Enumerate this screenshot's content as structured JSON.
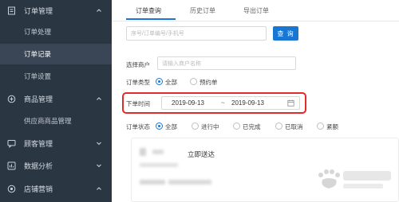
{
  "sidebar": {
    "sections": [
      {
        "label": "订单管理",
        "icon": "document-icon",
        "expanded": true
      },
      {
        "label": "商品管理",
        "icon": "add-circle-icon",
        "expanded": true
      },
      {
        "label": "顾客管理",
        "icon": "chat-icon",
        "expanded": false
      },
      {
        "label": "数据分析",
        "icon": "chart-box-icon",
        "expanded": false
      },
      {
        "label": "店铺营销",
        "icon": "target-icon",
        "expanded": true
      }
    ],
    "order_items": [
      "订单处理",
      "订单记录",
      "订单设置"
    ],
    "product_items": [
      "供应商商品管理"
    ],
    "active_item": "订单记录"
  },
  "tabs": [
    "订单查询",
    "历史订单",
    "导出订单"
  ],
  "search": {
    "placeholder": "序号/订单编号/手机号",
    "button_label": "查 询"
  },
  "filters": {
    "merchant_label": "选择商户",
    "merchant_placeholder": "请输入商户名称",
    "order_type_label": "订单类型",
    "order_type_options": [
      "全部",
      "预约单"
    ],
    "order_type_selected": "全部",
    "order_time_label": "下单时间",
    "date_start": "2019-09-13",
    "date_sep": "~",
    "date_end": "2019-09-13",
    "order_status_label": "订单状态",
    "order_status_options": [
      "全部",
      "进行中",
      "已完成",
      "已取消",
      "紧额"
    ],
    "order_status_selected": "全部"
  },
  "card": {
    "status_text": "立即送达"
  },
  "colors": {
    "sidebar_bg": "#2b3643",
    "accent": "#1976d2",
    "highlight_box": "#e22a2a"
  }
}
